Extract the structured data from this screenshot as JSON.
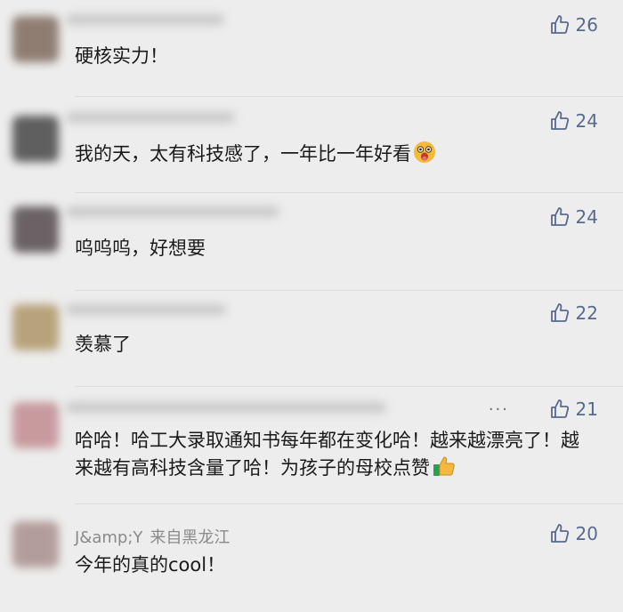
{
  "comments": [
    {
      "user": "",
      "location": "",
      "text": "硬核实力！",
      "likes": "26",
      "avatar_color": "#8f7d72",
      "emoji": ""
    },
    {
      "user": "",
      "location": "",
      "text": "我的天，太有科技感了，一年比一年好看",
      "likes": "24",
      "avatar_color": "#5f5f5f",
      "emoji": "drooling-face-emoji"
    },
    {
      "user": "",
      "location": "",
      "text": "呜呜呜，好想要",
      "likes": "24",
      "avatar_color": "#6a6264",
      "emoji": ""
    },
    {
      "user": "",
      "location": "",
      "text": "羡慕了",
      "likes": "22",
      "avatar_color": "#b8a27b",
      "emoji": ""
    },
    {
      "user": "",
      "location": "",
      "text": "哈哈！哈工大录取通知书每年都在变化哈！越来越漂亮了！越来越有高科技含量了哈！为孩子的母校点赞",
      "likes": "21",
      "avatar_color": "#c79a9e",
      "emoji": "thumbs-up-emoji",
      "menu": "···"
    },
    {
      "user": "J&amp;Y",
      "location": "来自黑龙江",
      "text": "今年的真的cool！",
      "likes": "20",
      "avatar_color": "#b39d9a",
      "emoji": ""
    }
  ],
  "colors": {
    "background": "#ededed",
    "like": "#58698f",
    "meta_text": "#8a8a8a"
  },
  "icons": {
    "like": "thumbs-up-outline-icon",
    "more": "more-dots-icon"
  }
}
